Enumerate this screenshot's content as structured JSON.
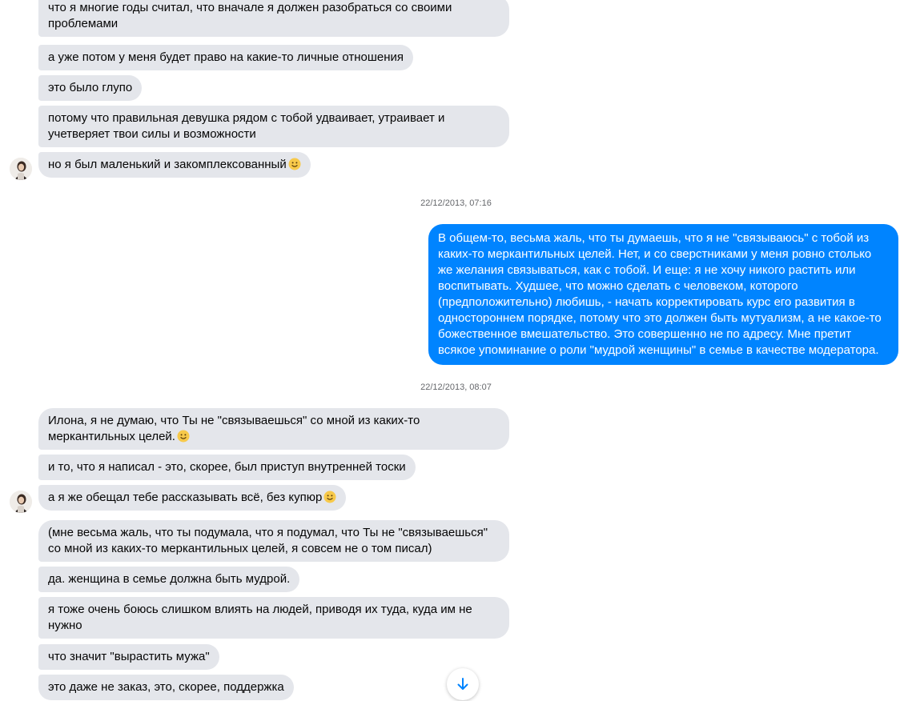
{
  "conversation": {
    "messages": [
      {
        "from": "them",
        "text": "что я многие годы считал, что вначале я должен разобраться со своими проблемами",
        "emoji": false
      },
      {
        "from": "them",
        "text": "а уже потом у меня будет право на какие-то личные отношения",
        "emoji": false
      },
      {
        "from": "them",
        "text": "это было глупо",
        "emoji": false
      },
      {
        "from": "them",
        "text": "потому что правильная девушка рядом с тобой удваивает, утраивает и учетверяет твои силы и возможности",
        "emoji": false
      },
      {
        "from": "them",
        "text": "но я был маленький и закомплексованный",
        "emoji": true
      },
      {
        "from": "me",
        "text": "В общем-то, весьма жаль, что ты думаешь, что я не \"связываюсь\" с тобой из каких-то меркантильных целей. Нет, и со сверстниками у меня ровно столько же желания связываться, как с тобой. И еще: я не хочу никого растить или воспитывать. Худшее, что можно сделать с человеком, которого (предположительно) любишь, - начать корректировать курс его развития в одностороннем порядке, потому что это должен быть мутуализм, а не какое-то божественное вмешательство. Это совершенно не по адресу. Мне претит всякое упоминание о роли \"мудрой женщины\" в семье в качестве модератора.",
        "emoji": false
      },
      {
        "from": "them",
        "text": "Илона, я не думаю, что Ты  не \"связываешься\" со мной из каких-то меркантильных целей.",
        "emoji": true
      },
      {
        "from": "them",
        "text": "и то, что я написал - это, скорее, был приступ внутренней тоски",
        "emoji": false
      },
      {
        "from": "them",
        "text": "а я же обещал тебе рассказывать всё, без купюр",
        "emoji": true
      },
      {
        "from": "them",
        "text": "(мне весьма жаль, что ты подумала, что я подумал, что Ты  не \"связываешься\" со мной из каких-то меркантильных целей, я совсем не о том писал)",
        "emoji": false
      },
      {
        "from": "them",
        "text": "да. женщина в семье должна быть мудрой.",
        "emoji": false
      },
      {
        "from": "them",
        "text": "я тоже очень боюсь слишком влиять на людей, приводя их туда, куда им не нужно",
        "emoji": false
      },
      {
        "from": "them",
        "text": "что значит \"вырастить мужа\"",
        "emoji": false
      },
      {
        "from": "them",
        "text": "это даже не заказ, это, скорее, поддержка",
        "emoji": false
      }
    ],
    "timestamps": [
      "22/12/2013, 07:16",
      "22/12/2013, 08:07"
    ]
  },
  "icons": {
    "avatar": "contact-avatar",
    "smile": "smiley-emoji-icon",
    "scroll": "arrow-down-icon"
  },
  "colors": {
    "incoming_bubble": "#e4e6eb",
    "outgoing_bubble": "#0084ff",
    "timestamp_text": "#65676b",
    "scroll_arrow": "#0084ff"
  }
}
